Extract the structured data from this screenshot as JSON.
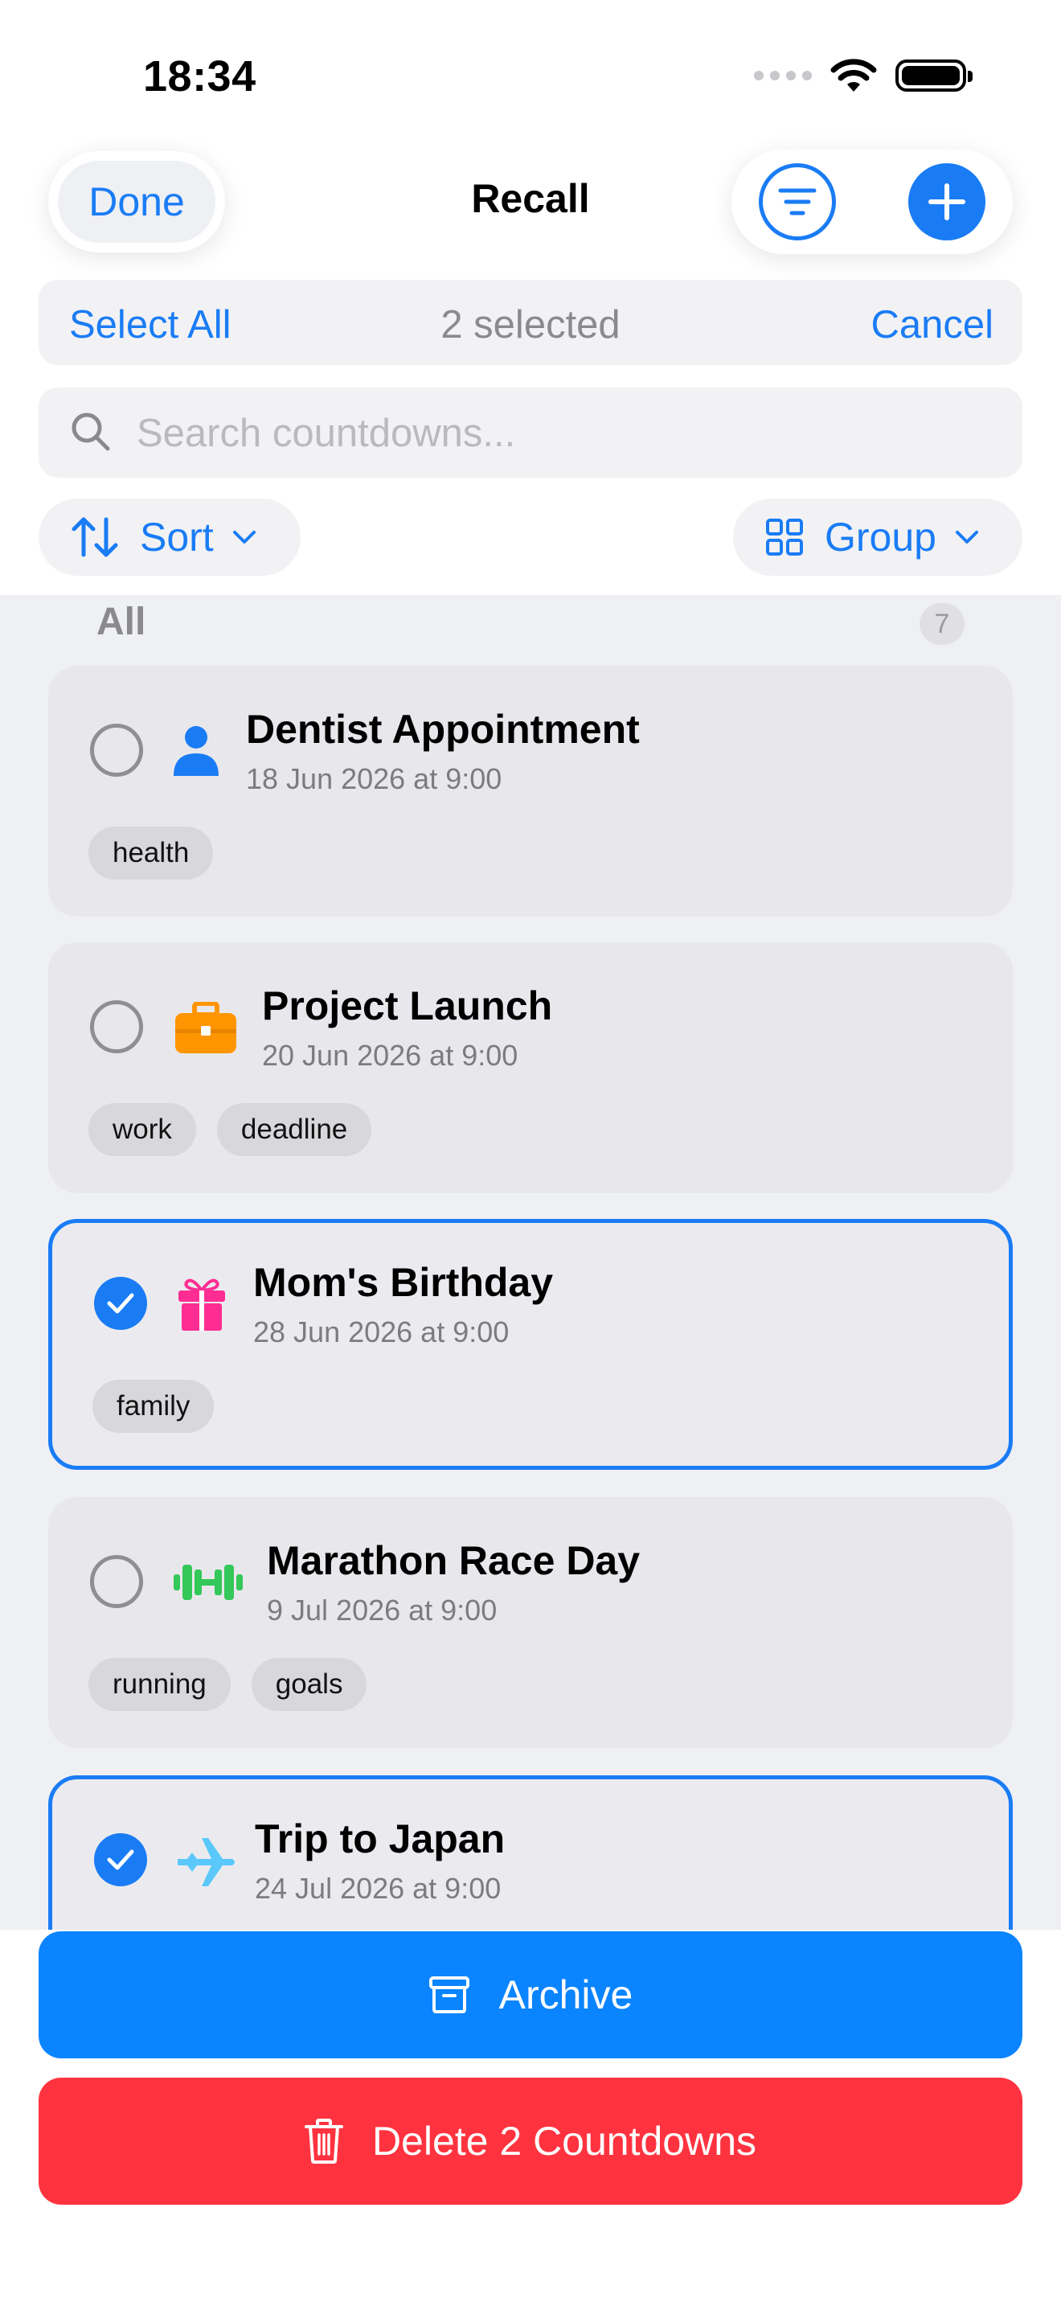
{
  "status_bar": {
    "time": "18:34"
  },
  "nav": {
    "done_label": "Done",
    "title": "Recall"
  },
  "selection": {
    "select_all_label": "Select All",
    "selected_count": "2 selected",
    "cancel_label": "Cancel"
  },
  "search": {
    "placeholder": "Search countdowns..."
  },
  "controls": {
    "sort_label": "Sort",
    "group_label": "Group"
  },
  "section": {
    "title": "All",
    "count": "7"
  },
  "countdowns": [
    {
      "title": "Dentist Appointment",
      "date": "18 Jun 2026 at 9:00",
      "tags": [
        "health"
      ],
      "selected": false,
      "icon": "person-icon",
      "icon_color": "#1a7cf5"
    },
    {
      "title": "Project Launch",
      "date": "20 Jun 2026 at 9:00",
      "tags": [
        "work",
        "deadline"
      ],
      "selected": false,
      "icon": "briefcase-icon",
      "icon_color": "#ff9500"
    },
    {
      "title": "Mom's Birthday",
      "date": "28 Jun 2026 at 9:00",
      "tags": [
        "family"
      ],
      "selected": true,
      "icon": "gift-icon",
      "icon_color": "#ff2d92"
    },
    {
      "title": "Marathon Race Day",
      "date": "9 Jul 2026 at 9:00",
      "tags": [
        "running",
        "goals"
      ],
      "selected": false,
      "icon": "dumbbell-icon",
      "icon_color": "#34c759"
    },
    {
      "title": "Trip to Japan",
      "date": "24 Jul 2026 at 9:00",
      "tags": [],
      "selected": true,
      "icon": "airplane-icon",
      "icon_color": "#5ac8fa"
    }
  ],
  "actions": {
    "archive_label": "Archive",
    "delete_label": "Delete 2 Countdowns"
  },
  "colors": {
    "accent": "#1a7cf5",
    "destructive": "#ff333f",
    "archive": "#0a84ff"
  }
}
